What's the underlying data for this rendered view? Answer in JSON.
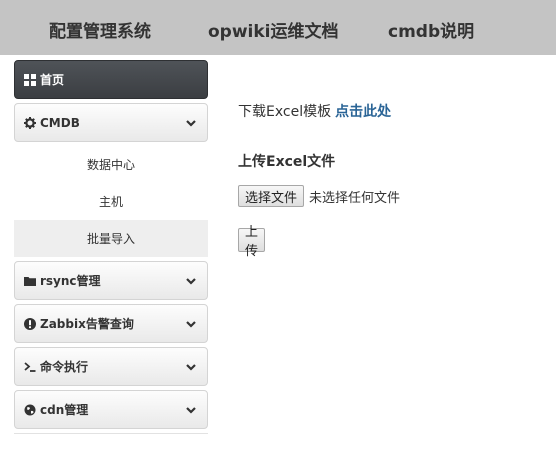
{
  "topnav": {
    "items": [
      "配置管理系统",
      "opwiki运维文档",
      "cmdb说明"
    ]
  },
  "sidebar": {
    "home_label": "首页",
    "cmdb_label": "CMDB",
    "cmdb_items": [
      "数据中心",
      "主机",
      "批量导入"
    ],
    "rsync_label": "rsync管理",
    "zabbix_label": "Zabbix告警查询",
    "cmd_label": "命令执行",
    "cdn_label": "cdn管理"
  },
  "main": {
    "download_text": "下载Excel模板",
    "download_link": "点击此处",
    "upload_title": "上传Excel文件",
    "choose_file_button": "选择文件",
    "file_status": "未选择任何文件",
    "upload_button": "上传"
  },
  "colors": {
    "topbar": "#c4c4c4",
    "active_panel": "#3f4246",
    "link": "#2a6496",
    "selected_item": "#eeeeee"
  }
}
